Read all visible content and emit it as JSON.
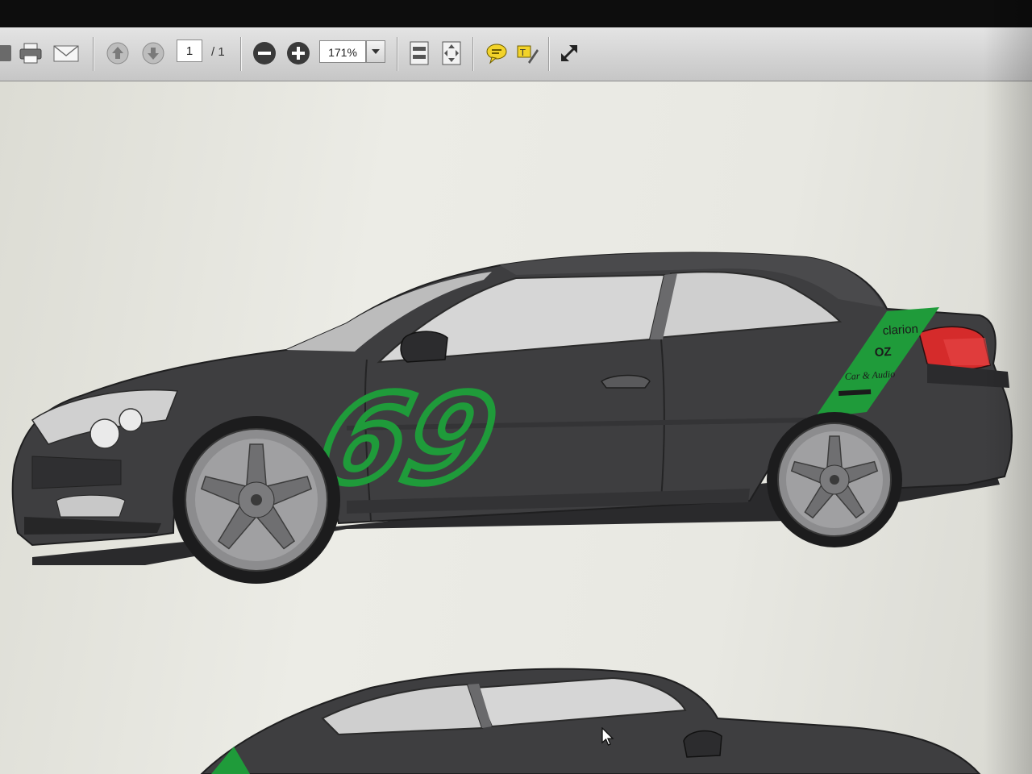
{
  "toolbar": {
    "page_current": "1",
    "page_total": "/ 1",
    "zoom": "171%",
    "buttons": [
      "print",
      "email",
      "previous-page",
      "next-page",
      "zoom-out",
      "zoom-in",
      "fit-page",
      "fit-width",
      "comment",
      "highlight-text",
      "full-screen"
    ]
  },
  "document": {
    "race_number": "69",
    "sponsors": [
      "clarion",
      "OZ",
      "Car & Audio"
    ]
  },
  "colors": {
    "car_body": "#3e3e40",
    "race_green": "#1f9b3a",
    "tail_light": "#d52b2b",
    "wheel": "#8c8c8e"
  }
}
